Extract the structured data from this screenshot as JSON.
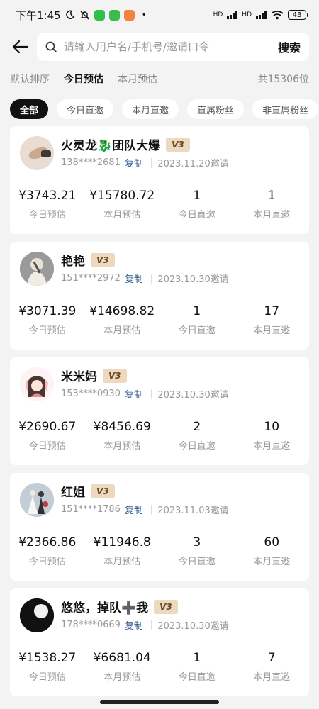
{
  "status_bar": {
    "time": "下午1:45",
    "network_1": "HD",
    "network_2": "HD",
    "battery": "43",
    "app_icon_colors": [
      "#2fbf4a",
      "#3dbb4f",
      "#f0843a"
    ]
  },
  "header": {
    "search_placeholder": "请输入用户名/手机号/邀请口令",
    "search_value": "",
    "search_button": "搜索"
  },
  "sort_tabs": [
    {
      "label": "默认排序",
      "active": false
    },
    {
      "label": "今日预估",
      "active": true
    },
    {
      "label": "本月预估",
      "active": false
    }
  ],
  "total_count": "共15306位",
  "filter_chips": [
    {
      "label": "全部",
      "active": true
    },
    {
      "label": "今日直邀",
      "active": false
    },
    {
      "label": "本月直邀",
      "active": false
    },
    {
      "label": "直属粉丝",
      "active": false
    },
    {
      "label": "非直属粉丝",
      "active": false
    }
  ],
  "stat_labels": [
    "今日预估",
    "本月预估",
    "今日直邀",
    "本月直邀"
  ],
  "copy_label": "复制",
  "users": [
    {
      "name": "火灵龙🐉团队大爆",
      "level": "V3",
      "phone": "138****2681",
      "invite_date": "2023.11.20邀请",
      "today_estimate": "¥3743.21",
      "month_estimate": "¥15780.72",
      "today_direct": "1",
      "month_direct": "1",
      "avatar_icon": "hand-photo-avatar",
      "avatar_color": "#c9b2a0"
    },
    {
      "name": "艳艳",
      "level": "V3",
      "phone": "151****2972",
      "invite_date": "2023.10.30邀请",
      "today_estimate": "¥3071.39",
      "month_estimate": "¥14698.82",
      "today_direct": "1",
      "month_direct": "17",
      "avatar_icon": "woman-back-avatar",
      "avatar_color": "#8e8e8e"
    },
    {
      "name": "米米妈",
      "level": "V3",
      "phone": "153****0930",
      "invite_date": "2023.10.30邀请",
      "today_estimate": "¥2690.67",
      "month_estimate": "¥8456.69",
      "today_direct": "2",
      "month_direct": "10",
      "avatar_icon": "cartoon-girl-avatar",
      "avatar_color": "#f6d6d8"
    },
    {
      "name": "红姐",
      "level": "V3",
      "phone": "151****1786",
      "invite_date": "2023.11.03邀请",
      "today_estimate": "¥2366.86",
      "month_estimate": "¥11946.8",
      "today_direct": "3",
      "month_direct": "60",
      "avatar_icon": "wedding-photo-avatar",
      "avatar_color": "#b9c3cf"
    },
    {
      "name": "悠悠，掉队➕我",
      "level": "V3",
      "phone": "178****0669",
      "invite_date": "2023.10.30邀请",
      "today_estimate": "¥1538.27",
      "month_estimate": "¥6681.04",
      "today_direct": "1",
      "month_direct": "7",
      "avatar_icon": "silhouette-avatar",
      "avatar_color": "#1a1a1a"
    }
  ]
}
